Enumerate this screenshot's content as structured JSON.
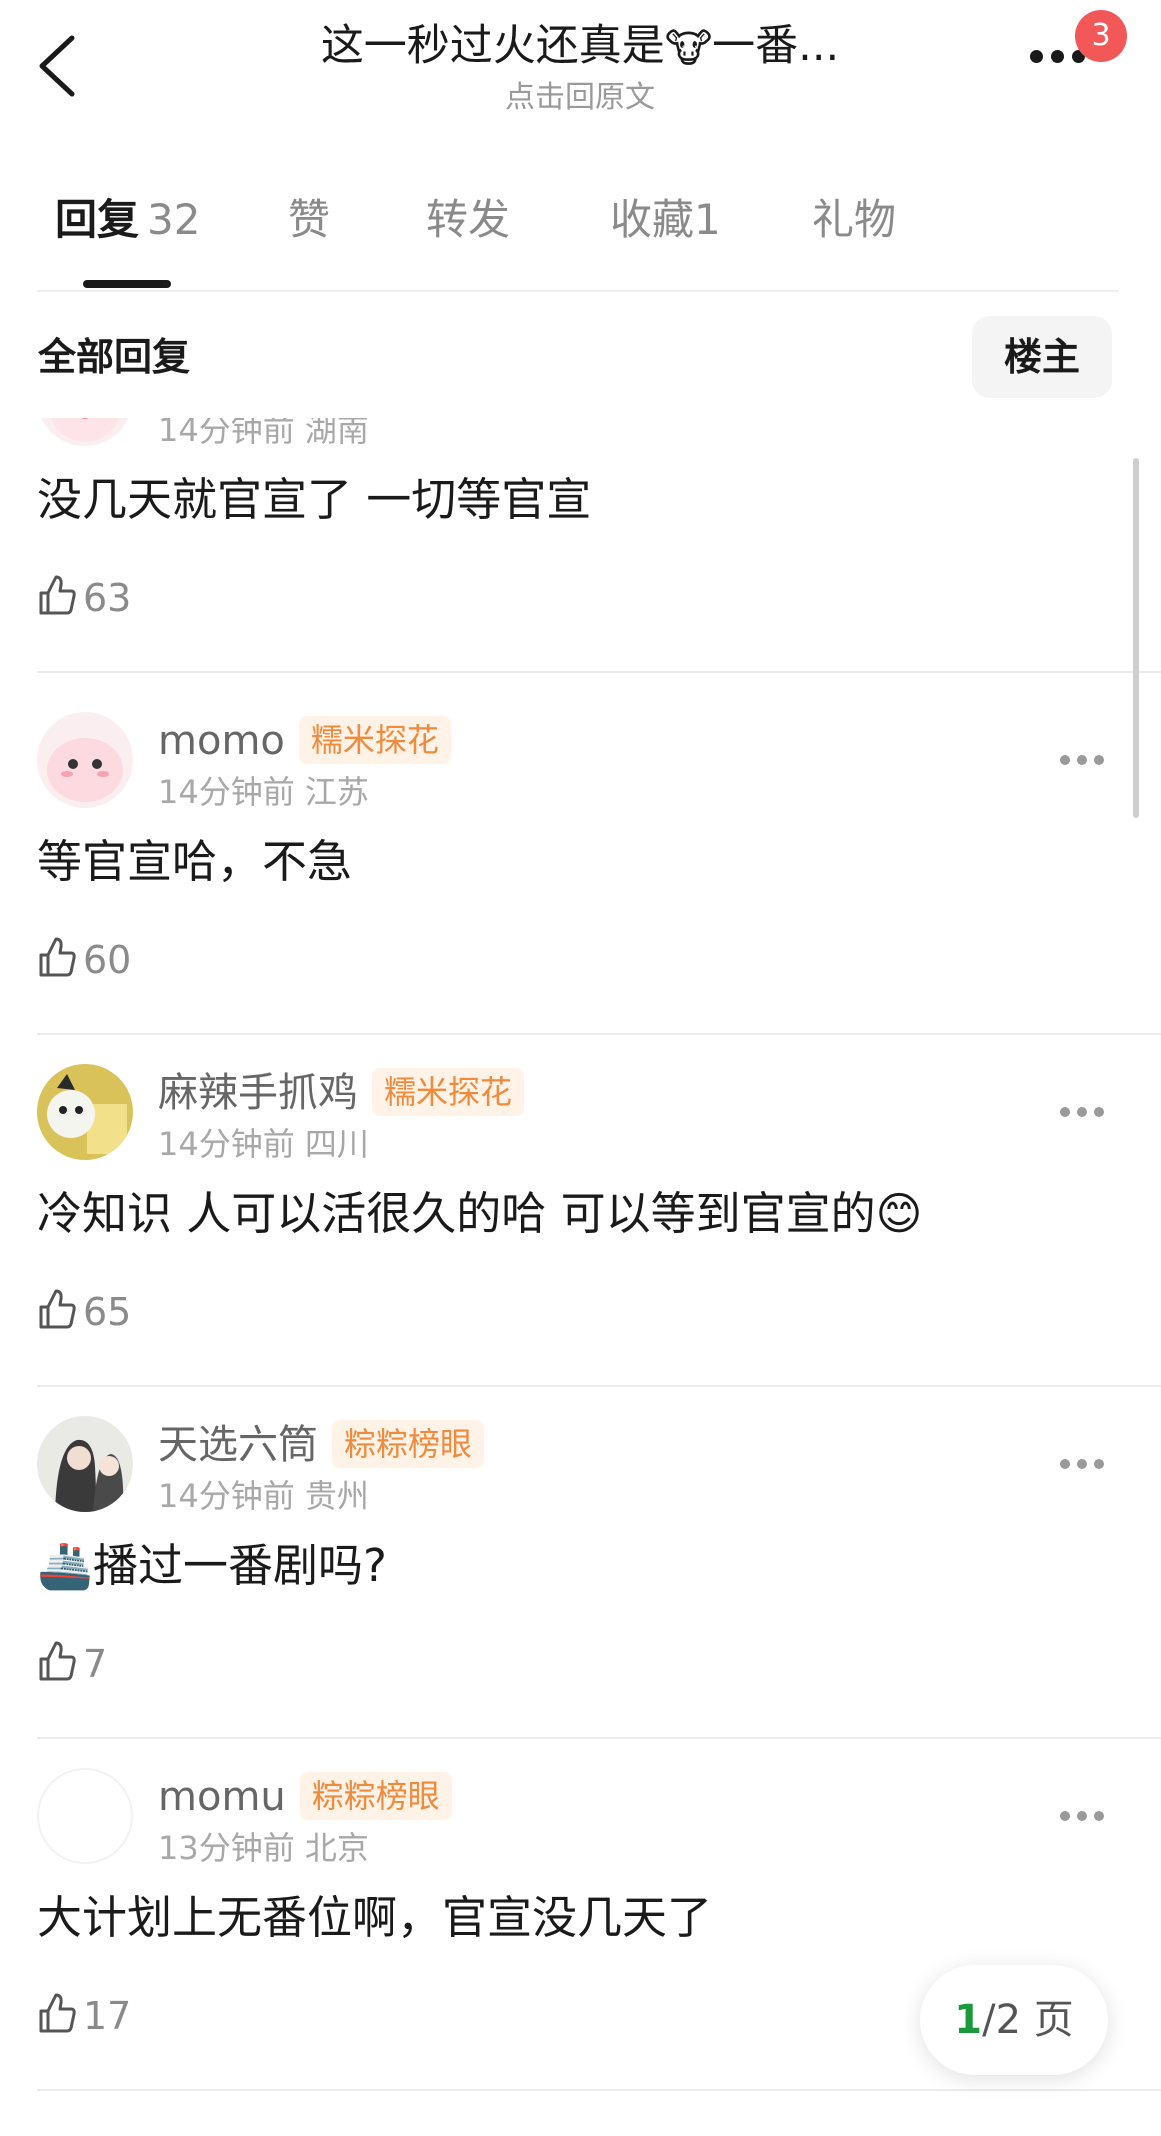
{
  "header": {
    "title_prefix": "这一秒过火还真是",
    "title_emoji": "🐮",
    "title_suffix": "一番...",
    "subtitle": "点击回原文",
    "notification_count": "3"
  },
  "tabs": [
    {
      "label": "回复",
      "count": "32"
    },
    {
      "label": "赞"
    },
    {
      "label": "转发"
    },
    {
      "label": "收藏1"
    },
    {
      "label": "礼物"
    }
  ],
  "section": {
    "title": "全部回复",
    "owner_filter": "楼主"
  },
  "comments": [
    {
      "name": "",
      "badge": "",
      "time": "14分钟前",
      "location": "湖南",
      "text": "没几天就官宣了 一切等官宣",
      "likes": "63"
    },
    {
      "name": "momo",
      "badge": "糯米探花",
      "time": "14分钟前",
      "location": "江苏",
      "text": "等官宣哈，不急",
      "likes": "60"
    },
    {
      "name": "麻辣手抓鸡",
      "badge": "糯米探花",
      "time": "14分钟前",
      "location": "四川",
      "text": "冷知识 人可以活很久的哈 可以等到官宣的",
      "emoji": "😊",
      "likes": "65"
    },
    {
      "name": "天选六筒",
      "badge": "粽粽榜眼",
      "time": "14分钟前",
      "location": "贵州",
      "emoji_prefix": "🚢",
      "text": "播过一番剧吗?",
      "likes": "7"
    },
    {
      "name": "momu",
      "badge": "粽粽榜眼",
      "time": "13分钟前",
      "location": "北京",
      "text": "大计划上无番位啊，官宣没几天了",
      "likes": "17"
    }
  ],
  "pagination": {
    "current": "1",
    "total_label": "/2 页"
  },
  "colors": {
    "badge_bg": "#fff2e6",
    "badge_text": "#f08a3c",
    "notification": "#f25858",
    "page_current": "#1a9a3a"
  }
}
